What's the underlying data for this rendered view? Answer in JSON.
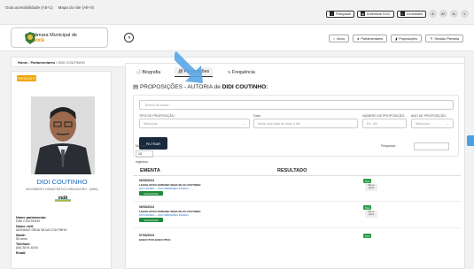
{
  "topbar": {
    "accessibility_label": "Guia acessibilidade (Alt+1)",
    "sitemap_label": "Mapa do site (Alt+0)",
    "buttons": [
      {
        "label": "Pesquisar",
        "icon": "search-icon"
      },
      {
        "label": "Autenticar DOC",
        "icon": "doc-icon"
      },
      {
        "label": "Contrastes",
        "icon": "contrast-icon"
      }
    ],
    "font_buttons": [
      "A",
      "A+",
      "A-",
      "◐"
    ]
  },
  "header": {
    "logo_line1": "Câmara Municipal de",
    "logo_line2": "Iporá",
    "nav": [
      {
        "label": "Início",
        "icon": "home-icon"
      },
      {
        "label": "Parlamentares",
        "icon": "user-icon"
      },
      {
        "label": "Proposições",
        "icon": "file-icon"
      },
      {
        "label": "Sessão Plenária",
        "icon": "gavel-icon"
      }
    ]
  },
  "breadcrumb": {
    "home": "Home",
    "sep1": "/",
    "section": "Parlamentares",
    "sep2": "/",
    "current": "DIDI COUTINHO"
  },
  "profile": {
    "badge": "PRESIDENTE",
    "name": "DIDI COUTINHO",
    "party": "MOVIMENTO DEMOCRÁTICO BRASILEIRO - (MDB)",
    "party_logo": "mdb",
    "fields": [
      {
        "label": "Nome parlamentar:",
        "value": "DIDI COUTINHO"
      },
      {
        "label": "Nome civil:",
        "value": "ADRIANO SENA SILVA COUTINHO"
      },
      {
        "label": "Idade:",
        "value": "55 anos"
      },
      {
        "label": "Telefone:",
        "value": "(64) 3674-4194"
      },
      {
        "label": "Email:",
        "value": ""
      }
    ]
  },
  "tabs": [
    {
      "label": "Biografia",
      "icon": "info-icon"
    },
    {
      "label": "Proposições",
      "icon": "doc-icon",
      "active": true
    },
    {
      "label": "Frequência",
      "icon": "pulse-icon"
    }
  ],
  "section_title_prefix": "PROPOSIÇÕES - AUTORIA de ",
  "section_title_name": "DIDI COUTINHO:",
  "filters": {
    "search_placeholder": "Termos da busca...",
    "type_label": "TIPO DE PROPOSIÇÃO:",
    "type_placeholder": "Selecione",
    "date_label": "Data:",
    "date_placeholder": "Insira uma data de início e fim",
    "number_label": "NÚMERO DE PROPOSIÇÃO:",
    "number_placeholder": "Ex: 150",
    "year_label": "ANO DE PROPOSIÇÃO:",
    "year_placeholder": "Selecione...",
    "button": "FILTRAR"
  },
  "table": {
    "show_label": "Mostrar",
    "length_value": "10",
    "records_label": "registros",
    "search_label": "Pesquisar:",
    "col_ementa": "EMENTA",
    "col_resultado": "RESULTADO",
    "rows": [
      {
        "date": "06/03/2024",
        "title": "LEGISLATIVO ADRIANO SENA SILVA COUTINHO",
        "sub": "ATA 15/2024 — ATA ORDINÁRIA 15/2024",
        "button": "VISUALIZAR",
        "status": "Tipo",
        "status2": "Não se aplica"
      },
      {
        "date": "06/03/2024",
        "title": "LEGISLATIVO ADRIANO SENA SILVA COUTINHO",
        "sub": "ATA 15/2024 — ATA ORDINÁRIA 15/2024",
        "button": "VISUALIZAR",
        "status": "Tipo",
        "status2": "Não se aplica"
      },
      {
        "date": "07/03/2024",
        "title": "EXECUTIVO EXECUTIVO",
        "sub": "",
        "button": "",
        "status": "Tipo",
        "status2": ""
      }
    ]
  }
}
